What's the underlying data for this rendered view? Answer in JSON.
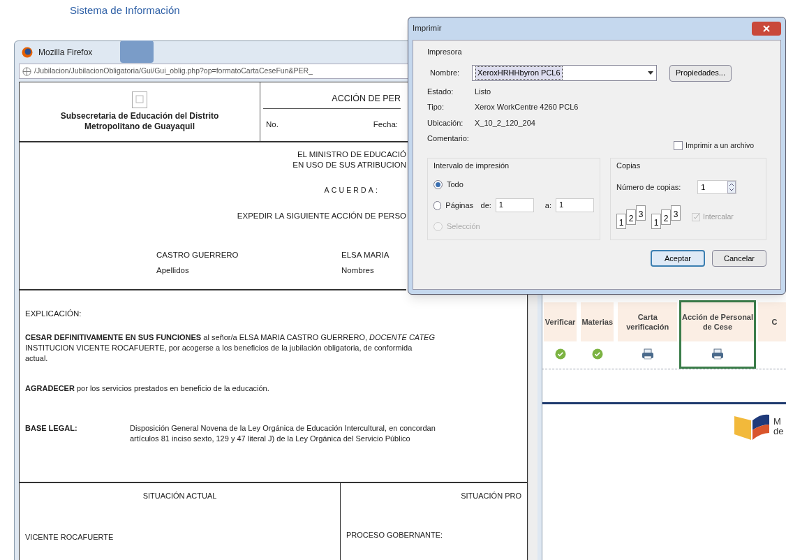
{
  "background_page": {
    "header_title": "Sistema de Información",
    "columns": [
      {
        "label": "Verificar",
        "kind": "check",
        "selected": false
      },
      {
        "label": "Materias",
        "kind": "check",
        "selected": false
      },
      {
        "label": "Carta verificación",
        "kind": "printer",
        "selected": false
      },
      {
        "label": "Acción de Personal de Cese",
        "kind": "printer",
        "selected": true
      },
      {
        "label": "C",
        "kind": "none",
        "selected": false
      }
    ],
    "logo_text": [
      "M",
      "de"
    ]
  },
  "browser": {
    "title": "Mozilla Firefox",
    "url": "/Jubilacion/JubilacionObligatoria/Gui/Gui_oblig.php?op=formatoCartaCeseFun&PER_",
    "document": {
      "org_name": "Subsecretaria de Educación del Distrito Metropolitano de Guayaquil",
      "title": "ACCIÓN DE PER",
      "no_label": "No.",
      "date_label": "Fecha:",
      "preamble": [
        "EL MINISTRO DE EDUCACIÓ",
        "EN USO DE SUS ATRIBUCION"
      ],
      "resolves": "ACUERDA:",
      "issue": "EXPEDIR LA SIGUIENTE ACCIÓN DE PERSO",
      "surnames": "CASTRO GUERRERO",
      "surnames_label": "Apellidos",
      "given_names": "ELSA MARIA",
      "given_names_label": "Nombres",
      "explanation_label": "EXPLICACIÓN:",
      "explanation_lines": [
        "**CESAR DEFINITIVAMENTE EN SUS FUNCIONES** al señor/a ELSA MARIA CASTRO GUERRERO, *DOCENTE CATEG*",
        "INSTITUCION VICENTE ROCAFUERTE, por acogerse a los beneficios de la jubilación obligatoria, de conformida",
        "actual."
      ],
      "thanks": "**AGRADECER** por los servicios prestados en beneficio de la educación.",
      "legal_label": "BASE LEGAL:",
      "legal_lines": [
        "Disposición General Novena de la Ley Orgánica de Educación Intercultural, en concordan",
        "artículos 81 inciso sexto, 129 y 47 literal J) de la Ley Orgánica del Servicio Público"
      ],
      "current_heading": "SITUACIÓN ACTUAL",
      "current_value": "VICENTE ROCAFUERTE",
      "proposed_heading": "SITUACIÓN PRO",
      "proposed_value": "PROCESO GOBERNANTE:"
    }
  },
  "print_dialog": {
    "title": "Imprimir",
    "printer_group": "Impresora",
    "name_label": "Nombre:",
    "name_value": "XeroxHRHHbyron PCL6",
    "properties_button": "Propiedades...",
    "info": [
      {
        "label": "Estado:",
        "value": "Listo"
      },
      {
        "label": "Tipo:",
        "value": "Xerox WorkCentre 4260 PCL6"
      },
      {
        "label": "Ubicación:",
        "value": "X_10_2_120_204"
      },
      {
        "label": "Comentario:"
      }
    ],
    "print_to_file": {
      "label": "Imprimir a un archivo",
      "checked": false
    },
    "range_group": "Intervalo de impresión",
    "range_options": [
      {
        "label": "Todo",
        "selected": true,
        "disabled": false
      },
      {
        "label": "Páginas",
        "selected": false,
        "disabled": false
      },
      {
        "label": "Selección",
        "selected": false,
        "disabled": true
      }
    ],
    "from_label": "de:",
    "from_value": "1",
    "to_label": "a:",
    "to_value": "1",
    "copies_group": "Copias",
    "copies_label": "Número de copias:",
    "copies_value": "1",
    "collate_stacks": [
      [
        "1",
        "2",
        "3"
      ],
      [
        "1",
        "2",
        "3"
      ]
    ],
    "collate": {
      "label": "Intercalar",
      "checked": true,
      "disabled": true
    },
    "buttons": [
      {
        "label": "Aceptar",
        "default": true
      },
      {
        "label": "Cancelar",
        "default": false
      }
    ]
  }
}
